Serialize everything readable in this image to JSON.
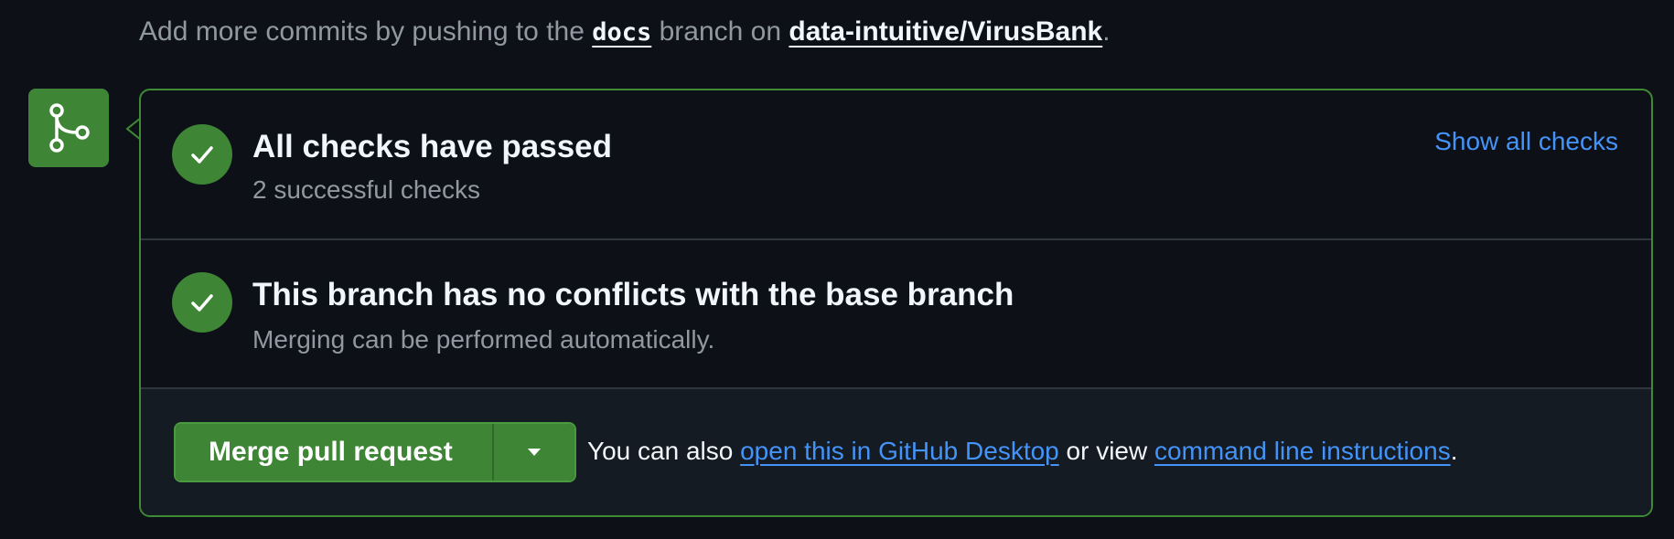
{
  "top_note": {
    "prefix": "Add more commits by pushing to the ",
    "branch": "docs",
    "middle": " branch on ",
    "repo": "data-intuitive/VirusBank",
    "suffix": "."
  },
  "checks": {
    "title": "All checks have passed",
    "subtitle": "2 successful checks",
    "show_all_label": "Show all checks"
  },
  "conflicts": {
    "title": "This branch has no conflicts with the base branch",
    "subtitle": "Merging can be performed automatically."
  },
  "merge": {
    "button_label": "Merge pull request",
    "also_prefix": "You can also ",
    "desktop_link": "open this in GitHub Desktop",
    "also_middle": " or view ",
    "cli_link": "command line instructions",
    "also_suffix": "."
  },
  "icons": {
    "merge_box": "git-merge-icon",
    "check": "check-icon",
    "dropdown": "triangle-down-icon"
  },
  "colors": {
    "success": "#3e8536",
    "link": "#4493f8",
    "border_success": "#3f8b35"
  }
}
